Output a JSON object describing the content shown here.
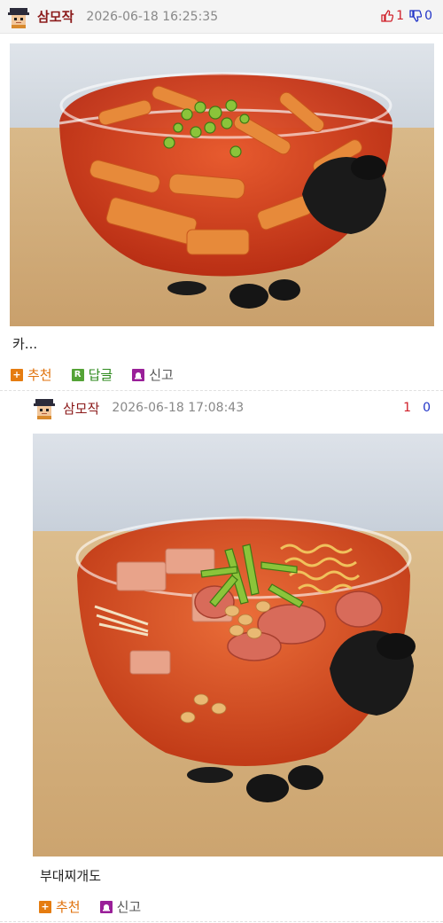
{
  "comments": [
    {
      "nickname": "삼모작",
      "datetime": "2026-06-18 16:25:35",
      "upvotes": "1",
      "downvotes": "0",
      "caption": "카...",
      "actions": {
        "recommend": "추천",
        "reply": "답글",
        "report": "신고"
      },
      "image_alt": "tteokbokki in glass bowl"
    },
    {
      "nickname": "삼모작",
      "datetime": "2026-06-18 17:08:43",
      "upvotes": "1",
      "downvotes": "0",
      "caption": "부대찌개도",
      "actions": {
        "recommend": "추천",
        "report": "신고"
      },
      "image_alt": "budae-jjigae in glass bowl"
    }
  ],
  "colors": {
    "nickname": "#8b1a1a",
    "upvote": "#d0202a",
    "downvote": "#2235c8",
    "recommend": "#e57c10",
    "reply": "#54a336",
    "report": "#9a1f99"
  }
}
